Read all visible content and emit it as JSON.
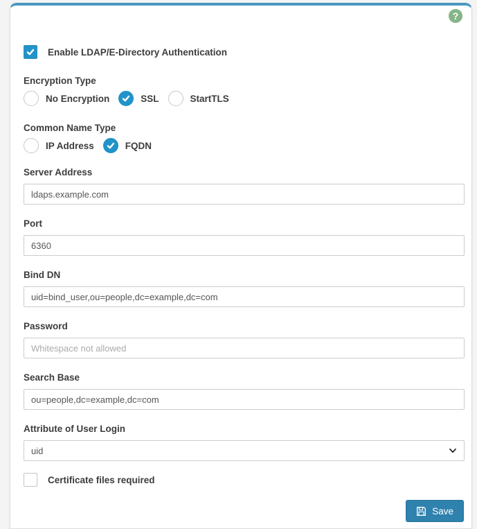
{
  "header": {
    "help_icon_glyph": "?"
  },
  "form": {
    "enable": {
      "label": "Enable LDAP/E-Directory Authentication",
      "checked": true
    },
    "encryption_type": {
      "label": "Encryption Type",
      "options": [
        {
          "label": "No Encryption",
          "selected": false
        },
        {
          "label": "SSL",
          "selected": true
        },
        {
          "label": "StartTLS",
          "selected": false
        }
      ]
    },
    "common_name_type": {
      "label": "Common Name Type",
      "options": [
        {
          "label": "IP Address",
          "selected": false
        },
        {
          "label": "FQDN",
          "selected": true
        }
      ]
    },
    "server_address": {
      "label": "Server Address",
      "value": "ldaps.example.com"
    },
    "port": {
      "label": "Port",
      "value": "6360"
    },
    "bind_dn": {
      "label": "Bind DN",
      "value": "uid=bind_user,ou=people,dc=example,dc=com"
    },
    "password": {
      "label": "Password",
      "value": "",
      "placeholder": "Whitespace not allowed"
    },
    "search_base": {
      "label": "Search Base",
      "value": "ou=people,dc=example,dc=com"
    },
    "attribute_of_user_login": {
      "label": "Attribute of User Login",
      "value": "uid"
    },
    "certificate_files": {
      "label": "Certificate files required",
      "checked": false
    },
    "save_label": "Save"
  },
  "colors": {
    "accent_blue": "#2193c8",
    "card_top_border": "#4a97c2",
    "save_button": "#2f81ae",
    "help_green": "#85b587",
    "page_background": "#f4f4f4",
    "label_text": "#3c3c3c",
    "input_border": "#cccccc",
    "placeholder_text": "#aaaaaa"
  }
}
